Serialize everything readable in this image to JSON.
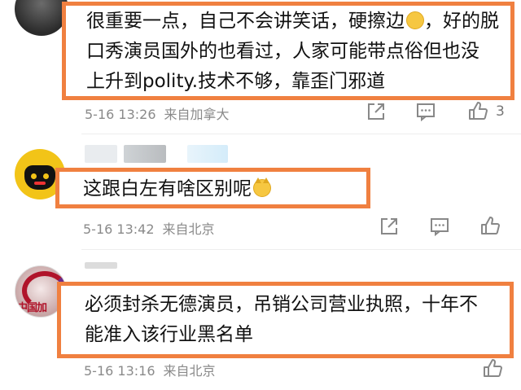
{
  "comments": [
    {
      "lines": [
        "很重要一点，自己不会讲笑话，硬擦边",
        "口秀演员国外的也看过，人家可能带点俗但也没",
        "上升到polity.技术不够，靠歪门邪道"
      ],
      "line1_suffix": "，好的脱",
      "time": "5-16 13:26",
      "location": "来自加拿大",
      "like_count": "3",
      "emoji": "flushed-face-emoji"
    },
    {
      "lines": [
        "这跟白左有啥区别呢"
      ],
      "time": "5-16 13:42",
      "location": "来自北京",
      "like_count": "",
      "emoji": "doge-cat-emoji"
    },
    {
      "lines": [
        "必须封杀无德演员，吊销公司营业执照，十年不",
        "能准入该行业黑名单"
      ],
      "time": "5-16 13:16",
      "location": "来自北京",
      "like_count": "",
      "emoji": ""
    }
  ],
  "avatars": {
    "third_text": "中国加"
  },
  "icons": [
    "share-icon",
    "comment-icon",
    "like-icon"
  ],
  "colors": {
    "highlight_border": "#f08040",
    "meta_text": "#8a8a8a"
  }
}
